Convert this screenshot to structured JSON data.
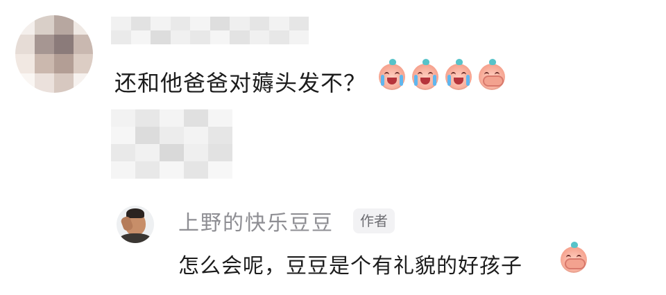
{
  "first_comment": {
    "text": "还和他爸爸对薅头发不？",
    "emojis": [
      {
        "icon": "crying-face-icon"
      },
      {
        "icon": "crying-face-icon"
      },
      {
        "icon": "crying-face-icon"
      },
      {
        "icon": "covering-mouth-face-icon"
      }
    ]
  },
  "reply": {
    "username": "上野的快乐豆豆",
    "badge": "作者",
    "text": "怎么会呢，豆豆是个有礼貌的好孩子",
    "emoji": {
      "icon": "covering-mouth-face-icon"
    }
  },
  "colors": {
    "text": "#1c1c1c",
    "username": "#8e8e93",
    "badge_bg": "#f2f2f4",
    "emoji_face": "#f6a38f",
    "emoji_sprout": "#57c3c9"
  }
}
